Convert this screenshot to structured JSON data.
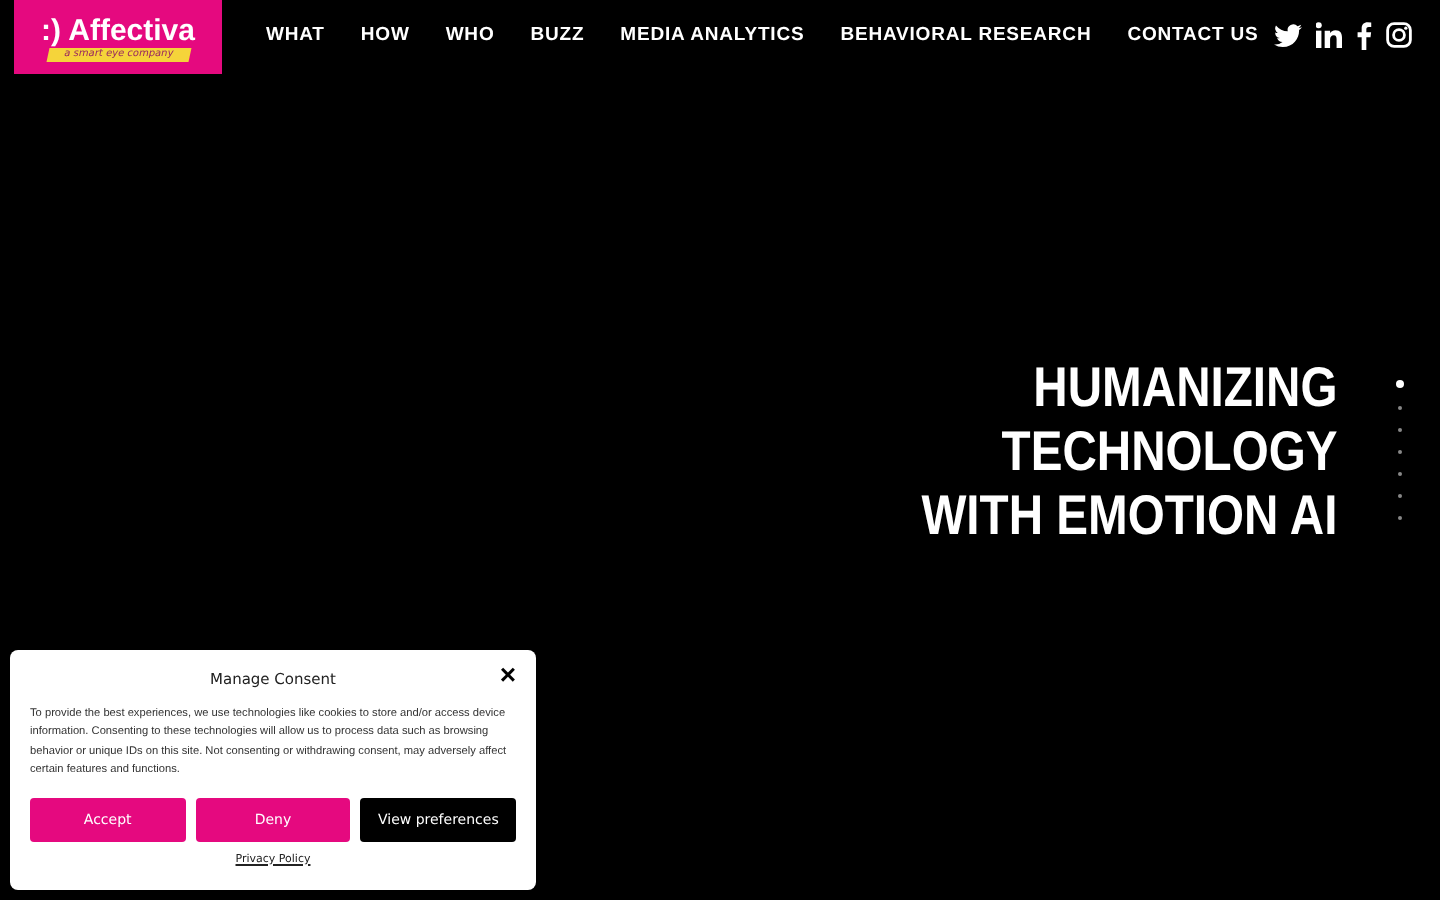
{
  "logo": {
    "text": ":) Affectiva",
    "tagline": "a smart eye company"
  },
  "nav": [
    "WHAT",
    "HOW",
    "WHO",
    "BUZZ",
    "MEDIA ANALYTICS",
    "BEHAVIORAL RESEARCH",
    "CONTACT US"
  ],
  "social": [
    {
      "kind": "twitter"
    },
    {
      "kind": "linkedin"
    },
    {
      "kind": "facebook"
    },
    {
      "kind": "instagram"
    }
  ],
  "hero": {
    "lines": [
      "HUMANIZING",
      "TECHNOLOGY",
      "WITH EMOTION AI"
    ]
  },
  "slide_dots": [
    {
      "selected": true
    },
    {
      "selected": false
    },
    {
      "selected": false
    },
    {
      "selected": false
    },
    {
      "selected": false
    },
    {
      "selected": false
    },
    {
      "selected": false
    }
  ],
  "consent": {
    "title": "Manage Consent",
    "close": "×",
    "text": "To provide the best experiences, we use technologies like cookies to store and/or access device information. Consenting to these technologies will allow us to process data such as browsing behavior or unique IDs on this site. Not consenting or withdrawing consent, may adversely affect certain features and functions.",
    "buttons": [
      {
        "label": "Accept",
        "kind": "primary"
      },
      {
        "label": "Deny",
        "kind": "primary"
      },
      {
        "label": "View preferences",
        "kind": "dark"
      }
    ],
    "link": "Privacy Policy"
  }
}
